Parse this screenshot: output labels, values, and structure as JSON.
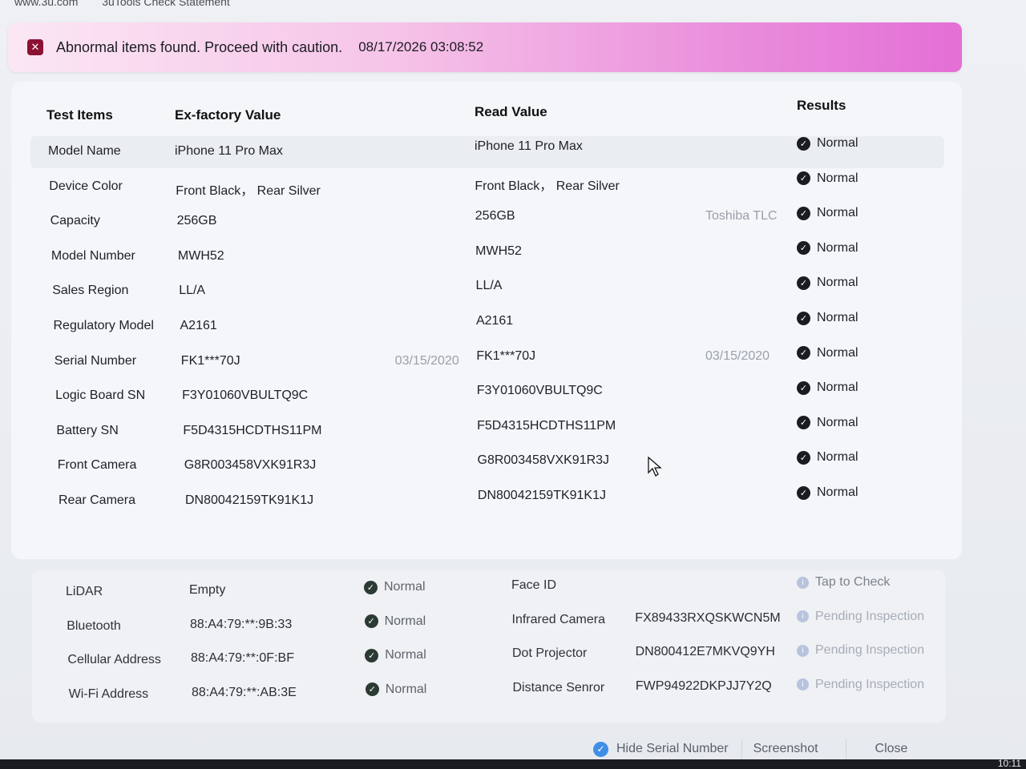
{
  "titlebar": {
    "url": "www.3u.com",
    "title": "3uTools Check Statement"
  },
  "banner": {
    "message": "Abnormal items found. Proceed with caution.",
    "timestamp": "08/17/2026 03:08:52",
    "icon": "error-icon"
  },
  "table": {
    "headers": {
      "items": "Test Items",
      "factory": "Ex-factory Value",
      "read": "Read Value",
      "results": "Results"
    },
    "rows": [
      {
        "item": "Model Name",
        "factory": "iPhone 11 Pro Max",
        "factory_note": "",
        "read": "iPhone 11 Pro Max",
        "read_note": "",
        "result": "Normal"
      },
      {
        "item": "Device Color",
        "factory": "Front Black， Rear Silver",
        "factory_note": "",
        "read": "Front Black， Rear Silver",
        "read_note": "",
        "result": "Normal"
      },
      {
        "item": "Capacity",
        "factory": "256GB",
        "factory_note": "",
        "read": "256GB",
        "read_note": "Toshiba TLC",
        "result": "Normal"
      },
      {
        "item": "Model Number",
        "factory": "MWH52",
        "factory_note": "",
        "read": "MWH52",
        "read_note": "",
        "result": "Normal"
      },
      {
        "item": "Sales Region",
        "factory": "LL/A",
        "factory_note": "",
        "read": "LL/A",
        "read_note": "",
        "result": "Normal"
      },
      {
        "item": "Regulatory Model",
        "factory": "A2161",
        "factory_note": "",
        "read": "A2161",
        "read_note": "",
        "result": "Normal"
      },
      {
        "item": "Serial Number",
        "factory": "FK1***70J",
        "factory_note": "03/15/2020",
        "read": "FK1***70J",
        "read_note": "03/15/2020",
        "result": "Normal"
      },
      {
        "item": "Logic Board SN",
        "factory": "F3Y01060VBULTQ9C",
        "factory_note": "",
        "read": "F3Y01060VBULTQ9C",
        "read_note": "",
        "result": "Normal"
      },
      {
        "item": "Battery SN",
        "factory": "F5D4315HCDTHS11PM",
        "factory_note": "",
        "read": "F5D4315HCDTHS11PM",
        "read_note": "",
        "result": "Normal"
      },
      {
        "item": "Front Camera",
        "factory": "G8R003458VXK91R3J",
        "factory_note": "",
        "read": "G8R003458VXK91R3J",
        "read_note": "",
        "result": "Normal"
      },
      {
        "item": "Rear Camera",
        "factory": "DN80042159TK91K1J",
        "factory_note": "",
        "read": "DN80042159TK91K1J",
        "read_note": "",
        "result": "Normal"
      }
    ]
  },
  "extra": {
    "left": [
      {
        "item": "LiDAR",
        "value": "Empty",
        "result": "Normal"
      },
      {
        "item": "Bluetooth",
        "value": "88:A4:79:**:9B:33",
        "result": "Normal"
      },
      {
        "item": "Cellular Address",
        "value": "88:A4:79:**:0F:BF",
        "result": "Normal"
      },
      {
        "item": "Wi-Fi Address",
        "value": "88:A4:79:**:AB:3E",
        "result": "Normal"
      }
    ],
    "right": [
      {
        "item": "Face ID",
        "value": "",
        "result": "Tap to Check"
      },
      {
        "item": "Infrared Camera",
        "value": "FX89433RXQSKWCN5M",
        "result": "Pending Inspection"
      },
      {
        "item": "Dot Projector",
        "value": "DN800412E7MKVQ9YH",
        "result": "Pending Inspection"
      },
      {
        "item": "Distance Senror",
        "value": "FWP94922DKPJJ7Y2Q",
        "result": "Pending Inspection"
      }
    ]
  },
  "footer": {
    "hide_serial": "Hide Serial Number",
    "screenshot": "Screenshot",
    "close": "Close"
  },
  "taskbar": {
    "clock": "10:11"
  },
  "colors": {
    "banner_accent": "#e46fd6",
    "error": "#8b1233",
    "checkbox": "#3f8fe8"
  }
}
